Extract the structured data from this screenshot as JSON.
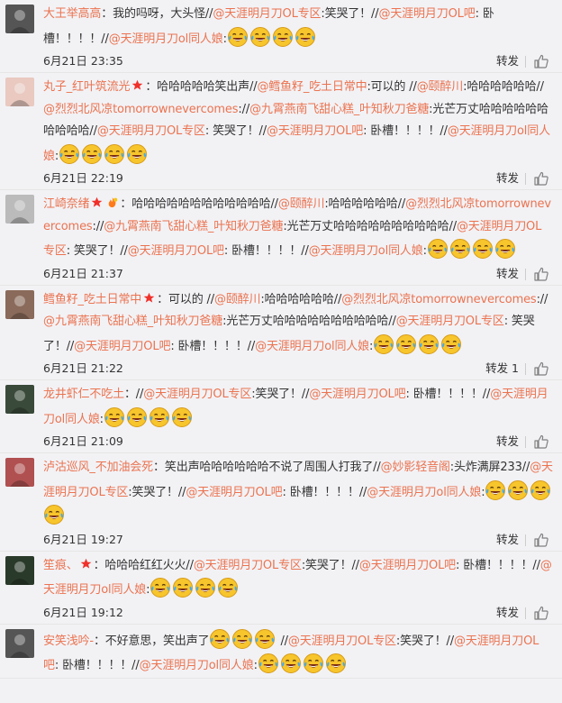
{
  "colors": {
    "accent": "#eb7350",
    "background": "#f2f2f5",
    "divider": "#e6e6e6"
  },
  "comments": [
    {
      "segments": [
        {
          "t": "user",
          "v": "大王举高高"
        },
        {
          "t": "text",
          "v": "：我的吗呀，大头怪//"
        },
        {
          "t": "mention",
          "v": "@天涯明月刀OL专区"
        },
        {
          "t": "text",
          "v": ":笑哭了！//"
        },
        {
          "t": "mention",
          "v": "@天涯明月刀OL吧"
        },
        {
          "t": "text",
          "v": ": 卧槽！！！！//"
        },
        {
          "t": "mention",
          "v": "@天涯明月刀ol同人娘"
        },
        {
          "t": "text",
          "v": ":"
        },
        {
          "t": "emoji",
          "v": 4
        }
      ],
      "time": "6月21日 23:35",
      "forward": "转发",
      "avatar_color": "#555"
    },
    {
      "segments": [
        {
          "t": "user",
          "v": "丸子_红叶筑流光"
        },
        {
          "t": "badge",
          "v": "star"
        },
        {
          "t": "text",
          "v": "：哈哈哈哈哈笑出声//"
        },
        {
          "t": "mention",
          "v": "@鳕鱼籽_吃土日常中"
        },
        {
          "t": "text",
          "v": ":可以的 //"
        },
        {
          "t": "mention",
          "v": "@颐醉川"
        },
        {
          "t": "text",
          "v": ":哈哈哈哈哈哈//"
        },
        {
          "t": "mention",
          "v": "@烈烈北风凉tomorrownevercomes"
        },
        {
          "t": "text",
          "v": "://"
        },
        {
          "t": "mention",
          "v": "@九霄燕南飞甜心糕_叶知秋刀爸糖"
        },
        {
          "t": "text",
          "v": ":光芒万丈哈哈哈哈哈哈哈哈哈哈//"
        },
        {
          "t": "mention",
          "v": "@天涯明月刀OL专区"
        },
        {
          "t": "text",
          "v": ": 笑哭了！//"
        },
        {
          "t": "mention",
          "v": "@天涯明月刀OL吧"
        },
        {
          "t": "text",
          "v": ": 卧槽！！！！//"
        },
        {
          "t": "mention",
          "v": "@天涯明月刀ol同人娘"
        },
        {
          "t": "text",
          "v": ":"
        },
        {
          "t": "emoji",
          "v": 4
        }
      ],
      "time": "6月21日 22:19",
      "forward": "转发",
      "avatar_color": "#e9c9c0"
    },
    {
      "segments": [
        {
          "t": "user",
          "v": "江崎奈绪"
        },
        {
          "t": "badge",
          "v": "star"
        },
        {
          "t": "badge",
          "v": "fire"
        },
        {
          "t": "text",
          "v": "：哈哈哈哈哈哈哈哈哈哈哈哈//"
        },
        {
          "t": "mention",
          "v": "@颐醉川"
        },
        {
          "t": "text",
          "v": ":哈哈哈哈哈哈//"
        },
        {
          "t": "mention",
          "v": "@烈烈北风凉tomorrownevercomes"
        },
        {
          "t": "text",
          "v": "://"
        },
        {
          "t": "mention",
          "v": "@九霄燕南飞甜心糕_叶知秋刀爸糖"
        },
        {
          "t": "text",
          "v": ":光芒万丈哈哈哈哈哈哈哈哈哈哈//"
        },
        {
          "t": "mention",
          "v": "@天涯明月刀OL专区"
        },
        {
          "t": "text",
          "v": ": 笑哭了！//"
        },
        {
          "t": "mention",
          "v": "@天涯明月刀OL吧"
        },
        {
          "t": "text",
          "v": ": 卧槽！！！！//"
        },
        {
          "t": "mention",
          "v": "@天涯明月刀ol同人娘"
        },
        {
          "t": "text",
          "v": ":"
        },
        {
          "t": "emoji",
          "v": 4
        }
      ],
      "time": "6月21日 21:37",
      "forward": "转发",
      "avatar_color": "#bbb"
    },
    {
      "segments": [
        {
          "t": "user",
          "v": "鳕鱼籽_吃土日常中"
        },
        {
          "t": "badge",
          "v": "star"
        },
        {
          "t": "text",
          "v": "：可以的 //"
        },
        {
          "t": "mention",
          "v": "@颐醉川"
        },
        {
          "t": "text",
          "v": ":哈哈哈哈哈哈//"
        },
        {
          "t": "mention",
          "v": "@烈烈北风凉tomorrownevercomes"
        },
        {
          "t": "text",
          "v": "://"
        },
        {
          "t": "mention",
          "v": "@九霄燕南飞甜心糕_叶知秋刀爸糖"
        },
        {
          "t": "text",
          "v": ":光芒万丈哈哈哈哈哈哈哈哈哈哈//"
        },
        {
          "t": "mention",
          "v": "@天涯明月刀OL专区"
        },
        {
          "t": "text",
          "v": ": 笑哭了！//"
        },
        {
          "t": "mention",
          "v": "@天涯明月刀OL吧"
        },
        {
          "t": "text",
          "v": ": 卧槽！！！！//"
        },
        {
          "t": "mention",
          "v": "@天涯明月刀ol同人娘"
        },
        {
          "t": "text",
          "v": ":"
        },
        {
          "t": "emoji",
          "v": 4
        }
      ],
      "time": "6月21日 21:22",
      "forward": "转发 1",
      "avatar_color": "#8a6a5a"
    },
    {
      "segments": [
        {
          "t": "user",
          "v": "龙井虾仁不吃土"
        },
        {
          "t": "text",
          "v": "：//"
        },
        {
          "t": "mention",
          "v": "@天涯明月刀OL专区"
        },
        {
          "t": "text",
          "v": ":笑哭了！//"
        },
        {
          "t": "mention",
          "v": "@天涯明月刀OL吧"
        },
        {
          "t": "text",
          "v": ": 卧槽！！！！//"
        },
        {
          "t": "mention",
          "v": "@天涯明月刀ol同人娘"
        },
        {
          "t": "text",
          "v": ":"
        },
        {
          "t": "emoji",
          "v": 4
        }
      ],
      "time": "6月21日 21:09",
      "forward": "转发",
      "avatar_color": "#3a4a3a"
    },
    {
      "segments": [
        {
          "t": "user",
          "v": "泸沽巡风_不加油会死"
        },
        {
          "t": "text",
          "v": "：笑出声哈哈哈哈哈哈不说了周围人打我了//"
        },
        {
          "t": "mention",
          "v": "@妙影轻音阁"
        },
        {
          "t": "text",
          "v": ":头炸满屏233//"
        },
        {
          "t": "mention",
          "v": "@天涯明月刀OL专区"
        },
        {
          "t": "text",
          "v": ":笑哭了！//"
        },
        {
          "t": "mention",
          "v": "@天涯明月刀OL吧"
        },
        {
          "t": "text",
          "v": ": 卧槽！！！！//"
        },
        {
          "t": "mention",
          "v": "@天涯明月刀ol同人娘"
        },
        {
          "t": "text",
          "v": ":"
        },
        {
          "t": "emoji",
          "v": 4
        }
      ],
      "time": "6月21日 19:27",
      "forward": "转发",
      "avatar_color": "#b05050"
    },
    {
      "segments": [
        {
          "t": "user",
          "v": "笙痕、"
        },
        {
          "t": "badge",
          "v": "star"
        },
        {
          "t": "text",
          "v": "：哈哈哈红红火火//"
        },
        {
          "t": "mention",
          "v": "@天涯明月刀OL专区"
        },
        {
          "t": "text",
          "v": ":笑哭了！//"
        },
        {
          "t": "mention",
          "v": "@天涯明月刀OL吧"
        },
        {
          "t": "text",
          "v": ": 卧槽！！！！//"
        },
        {
          "t": "mention",
          "v": "@天涯明月刀ol同人娘"
        },
        {
          "t": "text",
          "v": ":"
        },
        {
          "t": "emoji",
          "v": 4
        }
      ],
      "time": "6月21日 19:12",
      "forward": "转发",
      "avatar_color": "#2a3a2a"
    },
    {
      "segments": [
        {
          "t": "user",
          "v": "安笑浅吟-"
        },
        {
          "t": "text",
          "v": "：不好意思，笑出声了"
        },
        {
          "t": "emoji",
          "v": 3
        },
        {
          "t": "text",
          "v": " //"
        },
        {
          "t": "mention",
          "v": "@天涯明月刀OL专区"
        },
        {
          "t": "text",
          "v": ":笑哭了！//"
        },
        {
          "t": "mention",
          "v": "@天涯明月刀OL吧"
        },
        {
          "t": "text",
          "v": ": 卧槽！！！！//"
        },
        {
          "t": "mention",
          "v": "@天涯明月刀ol同人娘"
        },
        {
          "t": "text",
          "v": ":"
        },
        {
          "t": "emoji",
          "v": 4
        }
      ],
      "time": "",
      "forward": "",
      "avatar_color": "#555"
    }
  ]
}
